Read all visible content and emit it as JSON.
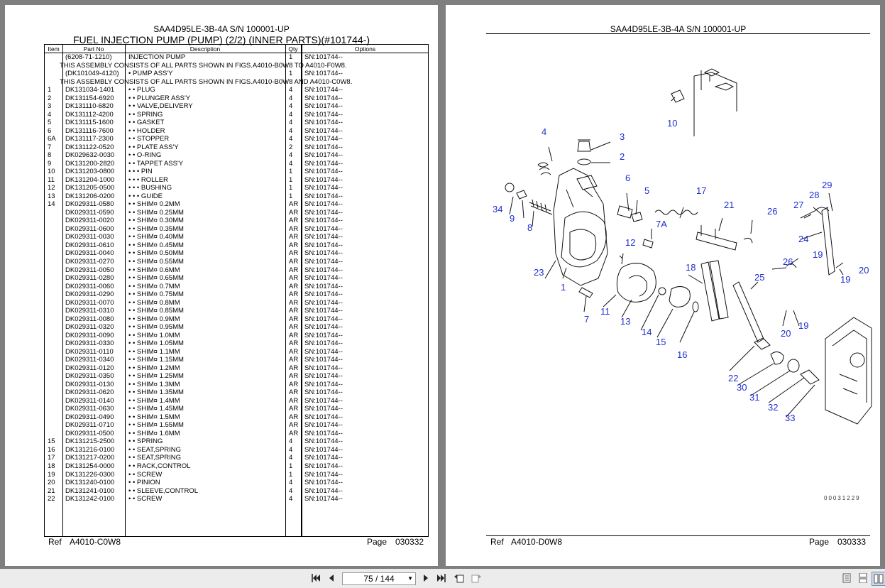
{
  "left_page": {
    "model": "SAA4D95LE-3B-4A S/N 100001-UP",
    "title": "FUEL INJECTION PUMP (PUMP) (2/2) (INNER PARTS)(#101744-)",
    "columns": {
      "item": "Item",
      "part_no": "Part No",
      "description": "Description",
      "qty": "Qty",
      "options": "Options"
    },
    "rows": [
      {
        "type": "part",
        "item": "",
        "part_no": "(6208-71-1210)",
        "desc": "INJECTION PUMP",
        "qty": "1",
        "opt": "SN:101744--"
      },
      {
        "type": "note",
        "text": "THIS ASSEMBLY CONSISTS OF ALL PARTS SHOWN IN FIGS.A4010-B0W8 TO A4010-F0W8."
      },
      {
        "type": "part",
        "item": "",
        "part_no": "(DK101049-4120)",
        "desc": "• PUMP ASS'Y",
        "qty": "1",
        "opt": "SN:101744--"
      },
      {
        "type": "note",
        "text": "THIS ASSEMBLY CONSISTS OF ALL PARTS SHOWN IN FIGS.A4010-B0W8 AND A4010-C0W8."
      },
      {
        "type": "part",
        "item": "1",
        "part_no": "DK131034-1401",
        "desc": "• • PLUG",
        "qty": "4",
        "opt": "SN:101744--"
      },
      {
        "type": "part",
        "item": "2",
        "part_no": "DK131154-6920",
        "desc": "• • PLUNGER ASS'Y",
        "qty": "4",
        "opt": "SN:101744--"
      },
      {
        "type": "part",
        "item": "3",
        "part_no": "DK131110-6820",
        "desc": "• • VALVE,DELIVERY",
        "qty": "4",
        "opt": "SN:101744--"
      },
      {
        "type": "part",
        "item": "4",
        "part_no": "DK131112-4200",
        "desc": "• • SPRING",
        "qty": "4",
        "opt": "SN:101744--"
      },
      {
        "type": "part",
        "item": "5",
        "part_no": "DK131115-1600",
        "desc": "• • GASKET",
        "qty": "4",
        "opt": "SN:101744--"
      },
      {
        "type": "part",
        "item": "6",
        "part_no": "DK131116-7600",
        "desc": "• • HOLDER",
        "qty": "4",
        "opt": "SN:101744--"
      },
      {
        "type": "part",
        "item": "6A",
        "part_no": "DK131117-2300",
        "desc": "• • STOPPER",
        "qty": "4",
        "opt": "SN:101744--"
      },
      {
        "type": "part",
        "item": "7",
        "part_no": "DK131122-0520",
        "desc": "• • PLATE ASS'Y",
        "qty": "2",
        "opt": "SN:101744--"
      },
      {
        "type": "part",
        "item": "8",
        "part_no": "DK029632-0030",
        "desc": "• • O-RING",
        "qty": "4",
        "opt": "SN:101744--"
      },
      {
        "type": "part",
        "item": "9",
        "part_no": "DK131200-2820",
        "desc": "• • TAPPET ASS'Y",
        "qty": "4",
        "opt": "SN:101744--"
      },
      {
        "type": "part",
        "item": "10",
        "part_no": "DK131203-0800",
        "desc": "• • • PIN",
        "qty": "1",
        "opt": "SN:101744--"
      },
      {
        "type": "part",
        "item": "11",
        "part_no": "DK131204-1000",
        "desc": "• • • ROLLER",
        "qty": "1",
        "opt": "SN:101744--"
      },
      {
        "type": "part",
        "item": "12",
        "part_no": "DK131205-0500",
        "desc": "• • • BUSHING",
        "qty": "1",
        "opt": "SN:101744--"
      },
      {
        "type": "part",
        "item": "13",
        "part_no": "DK131206-0200",
        "desc": "• • • GUIDE",
        "qty": "1",
        "opt": "SN:101744--"
      },
      {
        "type": "part",
        "item": "14",
        "part_no": "DK029311-0580",
        "desc": "• • SHIM¤ 0.2MM",
        "qty": "AR",
        "opt": "SN:101744--"
      },
      {
        "type": "part",
        "item": "",
        "part_no": "DK029311-0590",
        "desc": "• • SHIM¤ 0.25MM",
        "qty": "AR",
        "opt": "SN:101744--"
      },
      {
        "type": "part",
        "item": "",
        "part_no": "DK029311-0020",
        "desc": "• • SHIM¤ 0.30MM",
        "qty": "AR",
        "opt": "SN:101744--"
      },
      {
        "type": "part",
        "item": "",
        "part_no": "DK029311-0600",
        "desc": "• • SHIM¤ 0.35MM",
        "qty": "AR",
        "opt": "SN:101744--"
      },
      {
        "type": "part",
        "item": "",
        "part_no": "DK029311-0030",
        "desc": "• • SHIM¤ 0.40MM",
        "qty": "AR",
        "opt": "SN:101744--"
      },
      {
        "type": "part",
        "item": "",
        "part_no": "DK029311-0610",
        "desc": "• • SHIM¤ 0.45MM",
        "qty": "AR",
        "opt": "SN:101744--"
      },
      {
        "type": "part",
        "item": "",
        "part_no": "DK029311-0040",
        "desc": "• • SHIM¤ 0.50MM",
        "qty": "AR",
        "opt": "SN:101744--"
      },
      {
        "type": "part",
        "item": "",
        "part_no": "DK029311-0270",
        "desc": "• • SHIM¤ 0.55MM",
        "qty": "AR",
        "opt": "SN:101744--"
      },
      {
        "type": "part",
        "item": "",
        "part_no": "DK029311-0050",
        "desc": "• • SHIM¤ 0.6MM",
        "qty": "AR",
        "opt": "SN:101744--"
      },
      {
        "type": "part",
        "item": "",
        "part_no": "DK029311-0280",
        "desc": "• • SHIM¤ 0.65MM",
        "qty": "AR",
        "opt": "SN:101744--"
      },
      {
        "type": "part",
        "item": "",
        "part_no": "DK029311-0060",
        "desc": "• • SHIM¤ 0.7MM",
        "qty": "AR",
        "opt": "SN:101744--"
      },
      {
        "type": "part",
        "item": "",
        "part_no": "DK029311-0290",
        "desc": "• • SHIM¤ 0.75MM",
        "qty": "AR",
        "opt": "SN:101744--"
      },
      {
        "type": "part",
        "item": "",
        "part_no": "DK029311-0070",
        "desc": "• • SHIM¤ 0.8MM",
        "qty": "AR",
        "opt": "SN:101744--"
      },
      {
        "type": "part",
        "item": "",
        "part_no": "DK029311-0310",
        "desc": "• • SHIM¤ 0.85MM",
        "qty": "AR",
        "opt": "SN:101744--"
      },
      {
        "type": "part",
        "item": "",
        "part_no": "DK029311-0080",
        "desc": "• • SHIM¤ 0.9MM",
        "qty": "AR",
        "opt": "SN:101744--"
      },
      {
        "type": "part",
        "item": "",
        "part_no": "DK029311-0320",
        "desc": "• • SHIM¤ 0.95MM",
        "qty": "AR",
        "opt": "SN:101744--"
      },
      {
        "type": "part",
        "item": "",
        "part_no": "DK029311-0090",
        "desc": "• • SHIM¤ 1.0MM",
        "qty": "AR",
        "opt": "SN:101744--"
      },
      {
        "type": "part",
        "item": "",
        "part_no": "DK029311-0330",
        "desc": "• • SHIM¤ 1.05MM",
        "qty": "AR",
        "opt": "SN:101744--"
      },
      {
        "type": "part",
        "item": "",
        "part_no": "DK029311-0110",
        "desc": "• • SHIM¤ 1.1MM",
        "qty": "AR",
        "opt": "SN:101744--"
      },
      {
        "type": "part",
        "item": "",
        "part_no": "DK029311-0340",
        "desc": "• • SHIM¤ 1.15MM",
        "qty": "AR",
        "opt": "SN:101744--"
      },
      {
        "type": "part",
        "item": "",
        "part_no": "DK029311-0120",
        "desc": "• • SHIM¤ 1.2MM",
        "qty": "AR",
        "opt": "SN:101744--"
      },
      {
        "type": "part",
        "item": "",
        "part_no": "DK029311-0350",
        "desc": "• • SHIM¤ 1.25MM",
        "qty": "AR",
        "opt": "SN:101744--"
      },
      {
        "type": "part",
        "item": "",
        "part_no": "DK029311-0130",
        "desc": "• • SHIM¤ 1.3MM",
        "qty": "AR",
        "opt": "SN:101744--"
      },
      {
        "type": "part",
        "item": "",
        "part_no": "DK029311-0620",
        "desc": "• • SHIM¤ 1.35MM",
        "qty": "AR",
        "opt": "SN:101744--"
      },
      {
        "type": "part",
        "item": "",
        "part_no": "DK029311-0140",
        "desc": "• • SHIM¤ 1.4MM",
        "qty": "AR",
        "opt": "SN:101744--"
      },
      {
        "type": "part",
        "item": "",
        "part_no": "DK029311-0630",
        "desc": "• • SHIM¤ 1.45MM",
        "qty": "AR",
        "opt": "SN:101744--"
      },
      {
        "type": "part",
        "item": "",
        "part_no": "DK029311-0490",
        "desc": "• • SHIM¤ 1.5MM",
        "qty": "AR",
        "opt": "SN:101744--"
      },
      {
        "type": "part",
        "item": "",
        "part_no": "DK029311-0710",
        "desc": "• • SHIM¤ 1.55MM",
        "qty": "AR",
        "opt": "SN:101744--"
      },
      {
        "type": "part",
        "item": "",
        "part_no": "DK029311-0500",
        "desc": "• • SHIM¤ 1.6MM",
        "qty": "AR",
        "opt": "SN:101744--"
      },
      {
        "type": "part",
        "item": "15",
        "part_no": "DK131215-2500",
        "desc": "• • SPRING",
        "qty": "4",
        "opt": "SN:101744--"
      },
      {
        "type": "part",
        "item": "16",
        "part_no": "DK131216-0100",
        "desc": "• • SEAT,SPRING",
        "qty": "4",
        "opt": "SN:101744--"
      },
      {
        "type": "part",
        "item": "17",
        "part_no": "DK131217-0200",
        "desc": "• • SEAT,SPRING",
        "qty": "4",
        "opt": "SN:101744--"
      },
      {
        "type": "part",
        "item": "18",
        "part_no": "DK131254-0000",
        "desc": "• • RACK,CONTROL",
        "qty": "1",
        "opt": "SN:101744--"
      },
      {
        "type": "part",
        "item": "19",
        "part_no": "DK131226-0300",
        "desc": "• • SCREW",
        "qty": "1",
        "opt": "SN:101744--"
      },
      {
        "type": "part",
        "item": "20",
        "part_no": "DK131240-0100",
        "desc": "• • PINION",
        "qty": "4",
        "opt": "SN:101744--"
      },
      {
        "type": "part",
        "item": "21",
        "part_no": "DK131241-0100",
        "desc": "• • SLEEVE,CONTROL",
        "qty": "4",
        "opt": "SN:101744--"
      },
      {
        "type": "part",
        "item": "22",
        "part_no": "DK131242-0100",
        "desc": "• • SCREW",
        "qty": "4",
        "opt": "SN:101744--"
      }
    ],
    "ref_label": "Ref",
    "ref_value": "A4010-C0W8",
    "page_label": "Page",
    "page_value": "030332"
  },
  "right_page": {
    "model": "SAA4D95LE-3B-4A S/N 100001-UP",
    "callout_color": "#1f2fd0",
    "callouts": [
      "10",
      "4",
      "3",
      "2",
      "6",
      "5",
      "17",
      "21",
      "26",
      "29",
      "28",
      "27",
      "34",
      "9",
      "8",
      "7A",
      "24",
      "12",
      "19",
      "26",
      "20",
      "19",
      "23",
      "1",
      "18",
      "25",
      "7",
      "11",
      "13",
      "14",
      "15",
      "16",
      "20",
      "19",
      "22",
      "30",
      "31",
      "32",
      "33"
    ],
    "drawing_code": "00031229",
    "ref_label": "Ref",
    "ref_value": "A4010-D0W8",
    "page_label": "Page",
    "page_value": "030333"
  },
  "toolbar": {
    "first_icon": "first-page-icon",
    "prev_icon": "prev-page-icon",
    "page_indicator": "75 / 144",
    "next_icon": "next-page-icon",
    "last_icon": "last-page-icon",
    "back_icon": "previous-view-icon",
    "forward_icon": "next-view-icon",
    "view_icons": [
      "single-page-view-icon",
      "continuous-view-icon",
      "two-page-view-icon"
    ]
  }
}
